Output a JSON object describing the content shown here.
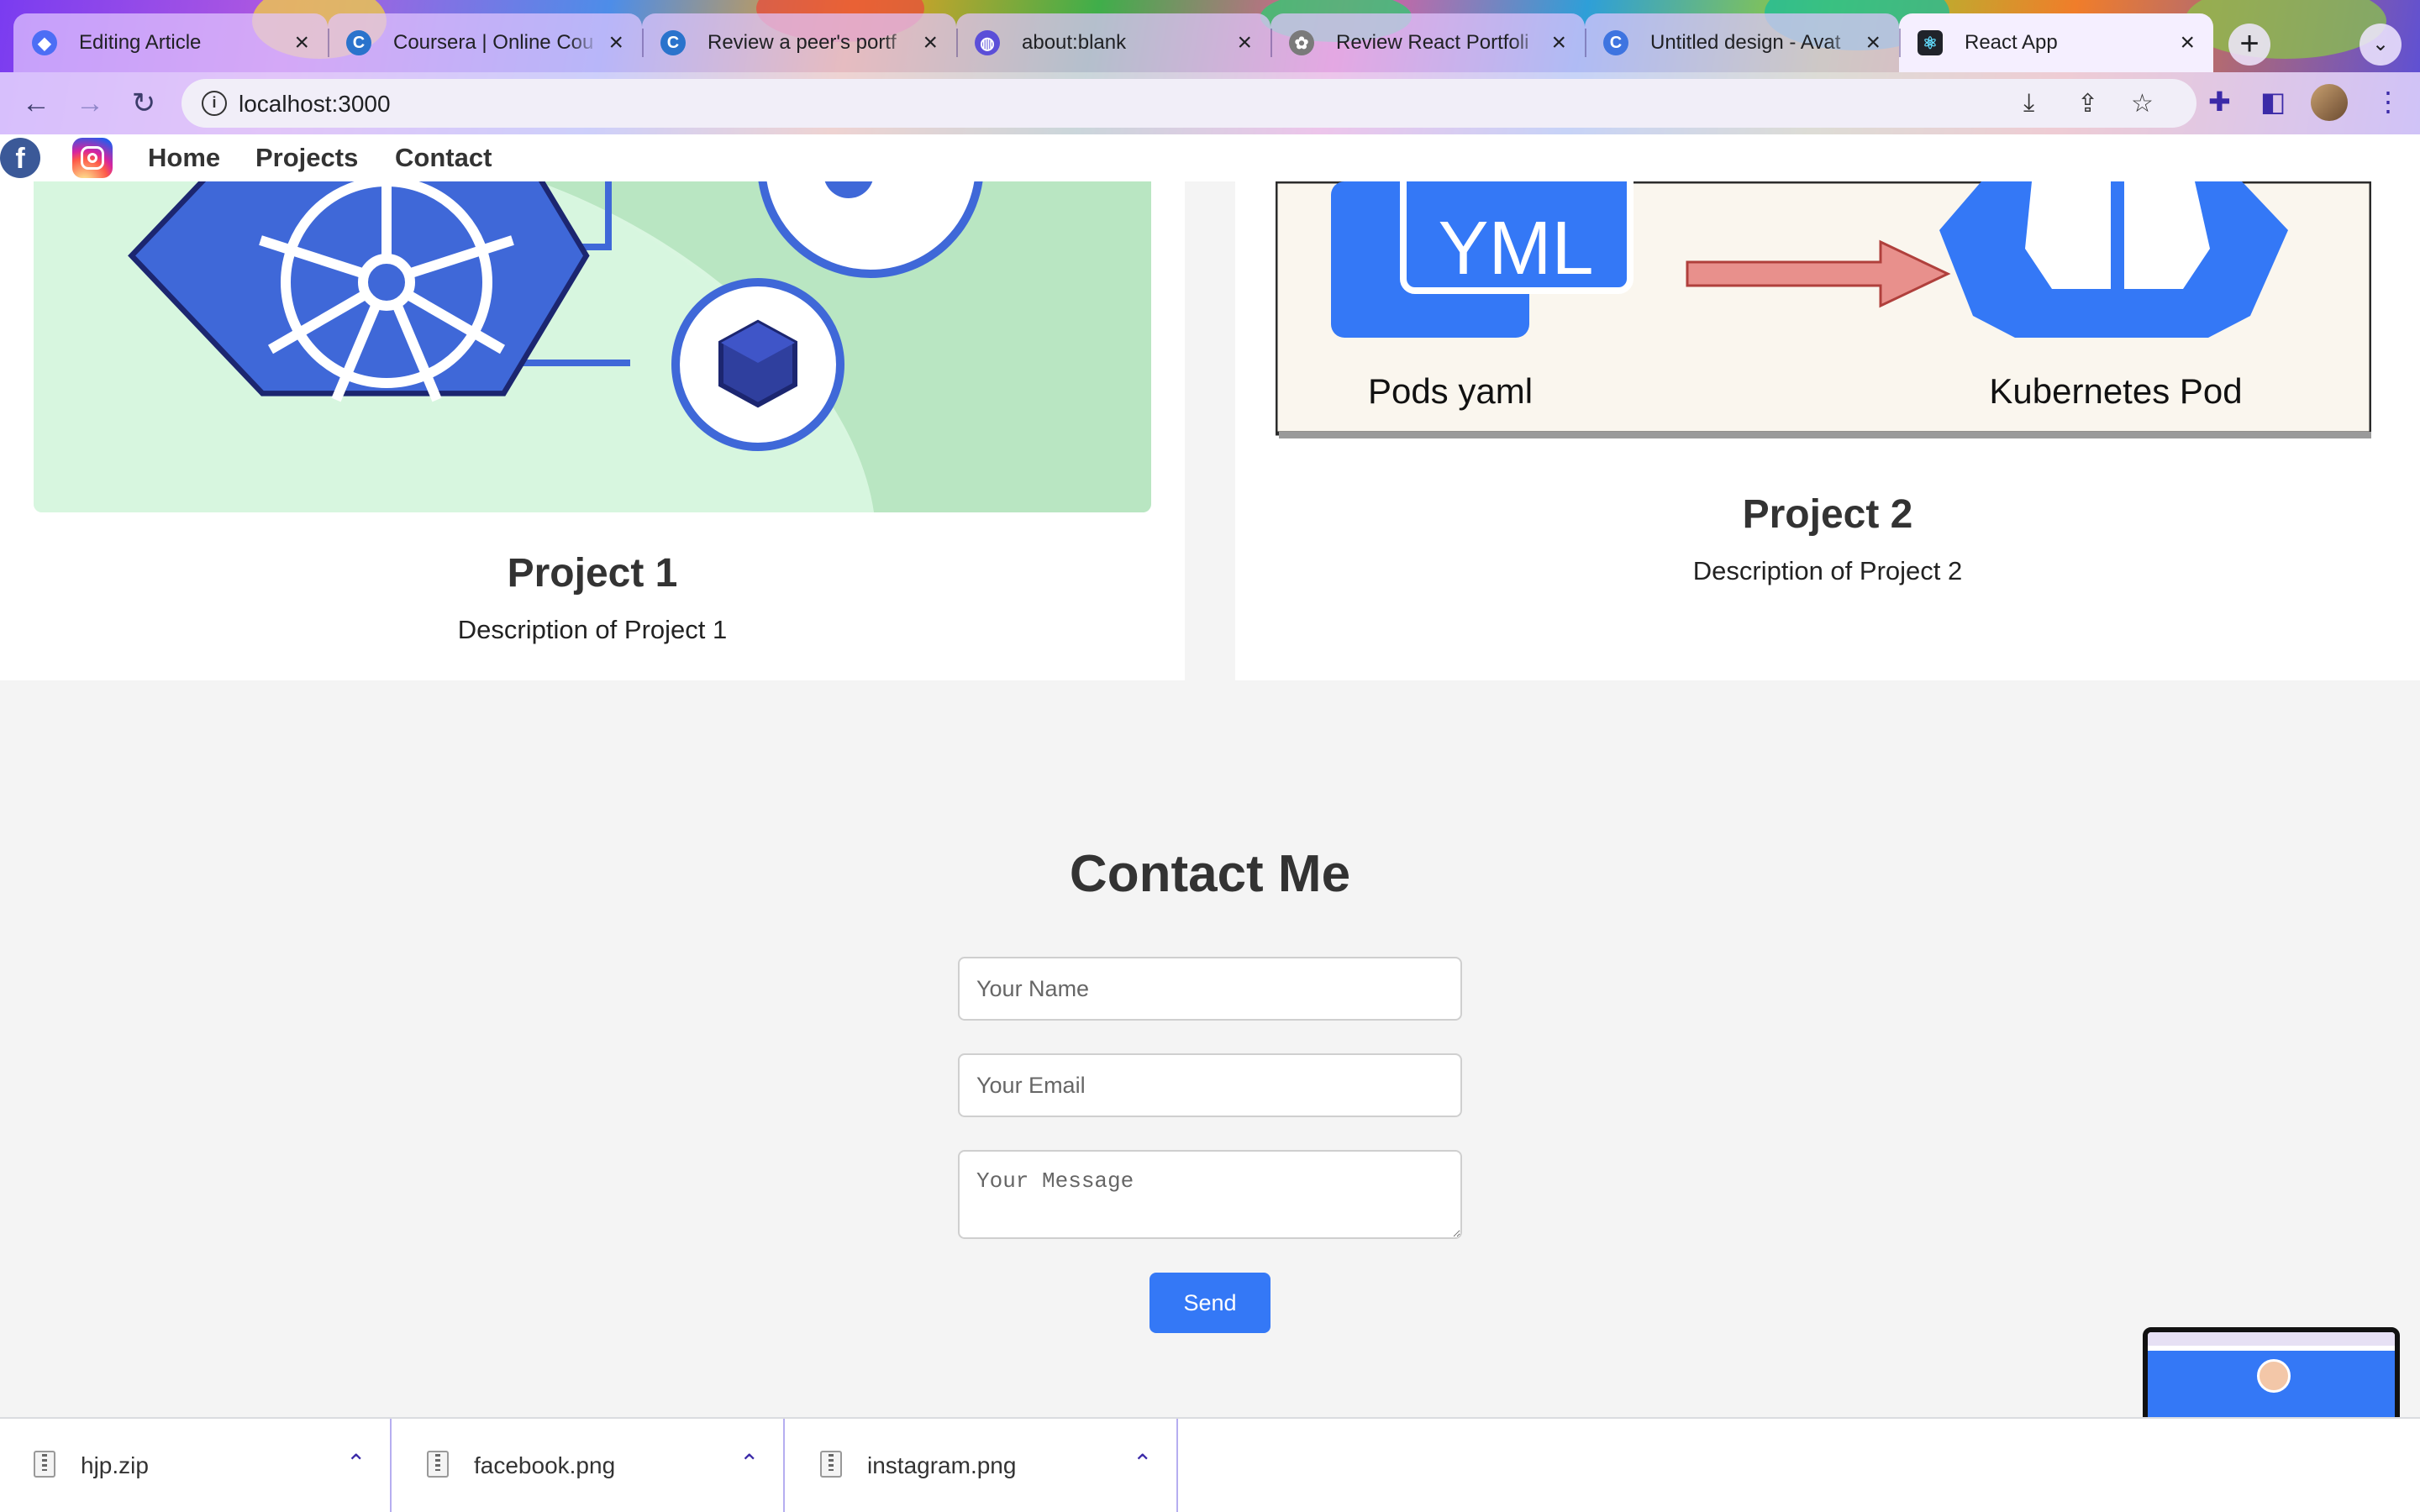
{
  "browser": {
    "tabs": [
      {
        "title": "Editing Article",
        "favicon": "blue-diamond-icon",
        "active": false
      },
      {
        "title": "Coursera | Online Cou",
        "favicon": "coursera-icon",
        "active": false
      },
      {
        "title": "Review a peer's portf",
        "favicon": "coursera-icon",
        "active": false
      },
      {
        "title": "about:blank",
        "favicon": "globe-icon",
        "active": false
      },
      {
        "title": "Review React Portfoli",
        "favicon": "openai-icon",
        "active": false
      },
      {
        "title": "Untitled design - Avat",
        "favicon": "canva-icon",
        "active": false
      },
      {
        "title": "React App",
        "favicon": "react-icon",
        "active": true
      }
    ],
    "url": "localhost:3000",
    "accent": "#3b2aa8"
  },
  "nav": {
    "links": [
      "Home",
      "Projects",
      "Contact"
    ]
  },
  "projects": [
    {
      "title": "Project 1",
      "description": "Description of Project 1"
    },
    {
      "title": "Project 2",
      "description": "Description of Project 2",
      "image_labels": {
        "yml": "YML",
        "left": "Pods yaml",
        "right": "Kubernetes Pod"
      }
    }
  ],
  "contact": {
    "title": "Contact Me",
    "name_placeholder": "Your Name",
    "email_placeholder": "Your Email",
    "message_placeholder": "Your Message",
    "send_label": "Send",
    "button_color": "#3478f6"
  },
  "downloads": [
    {
      "name": "hjp.zip"
    },
    {
      "name": "facebook.png"
    },
    {
      "name": "instagram.png"
    }
  ]
}
